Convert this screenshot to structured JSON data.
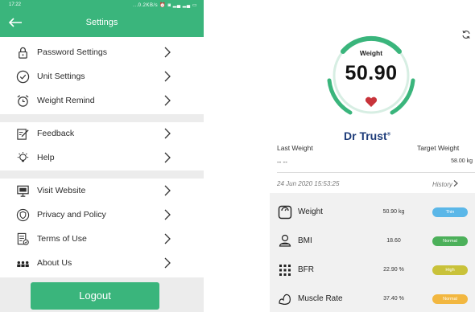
{
  "left": {
    "status": {
      "time": "17:22",
      "icons": "...0.2KB/s ⏰ ◙ ▂▄ ▂▄ ▭"
    },
    "appbar": {
      "title": "Settings"
    },
    "menu": [
      {
        "label": "Password Settings",
        "icon": "lock-icon"
      },
      {
        "label": "Unit Settings",
        "icon": "check-circle-icon"
      },
      {
        "label": "Weight Remind",
        "icon": "alarm-clock-icon"
      },
      {
        "label": "Feedback",
        "icon": "edit-icon"
      },
      {
        "label": "Help",
        "icon": "bulb-icon"
      },
      {
        "label": "Visit Website",
        "icon": "monitor-icon"
      },
      {
        "label": "Privacy and Policy",
        "icon": "shield-icon"
      },
      {
        "label": "Terms of Use",
        "icon": "document-icon"
      },
      {
        "label": "About Us",
        "icon": "people-icon"
      }
    ],
    "logout": "Logout"
  },
  "right": {
    "gauge": {
      "label": "Weight",
      "value": "50.90"
    },
    "brand": {
      "name": "Dr Trust",
      "mark": "®"
    },
    "last_weight": {
      "label": "Last Weight",
      "value": "-- --"
    },
    "target_weight": {
      "label": "Target Weight",
      "value": "58.00 kg"
    },
    "date": "24 Jun 2020 15:53:25",
    "history": "History",
    "metrics": [
      {
        "name": "Weight",
        "value": "50.90 kg",
        "status": "Thin",
        "color": "#5bb7e8",
        "icon": "scale-icon"
      },
      {
        "name": "BMI",
        "value": "18.60",
        "status": "Normal",
        "color": "#4cb05a",
        "icon": "bmi-icon"
      },
      {
        "name": "BFR",
        "value": "22.90 %",
        "status": "High",
        "color": "#c9c23a",
        "icon": "body-fat-icon"
      },
      {
        "name": "Muscle Rate",
        "value": "37.40 %",
        "status": "Normal",
        "color": "#f2b740",
        "icon": "muscle-icon"
      }
    ],
    "colors": {
      "accent": "#3ab57c",
      "heart": "#c8333a",
      "brand": "#1f3d7a"
    }
  }
}
